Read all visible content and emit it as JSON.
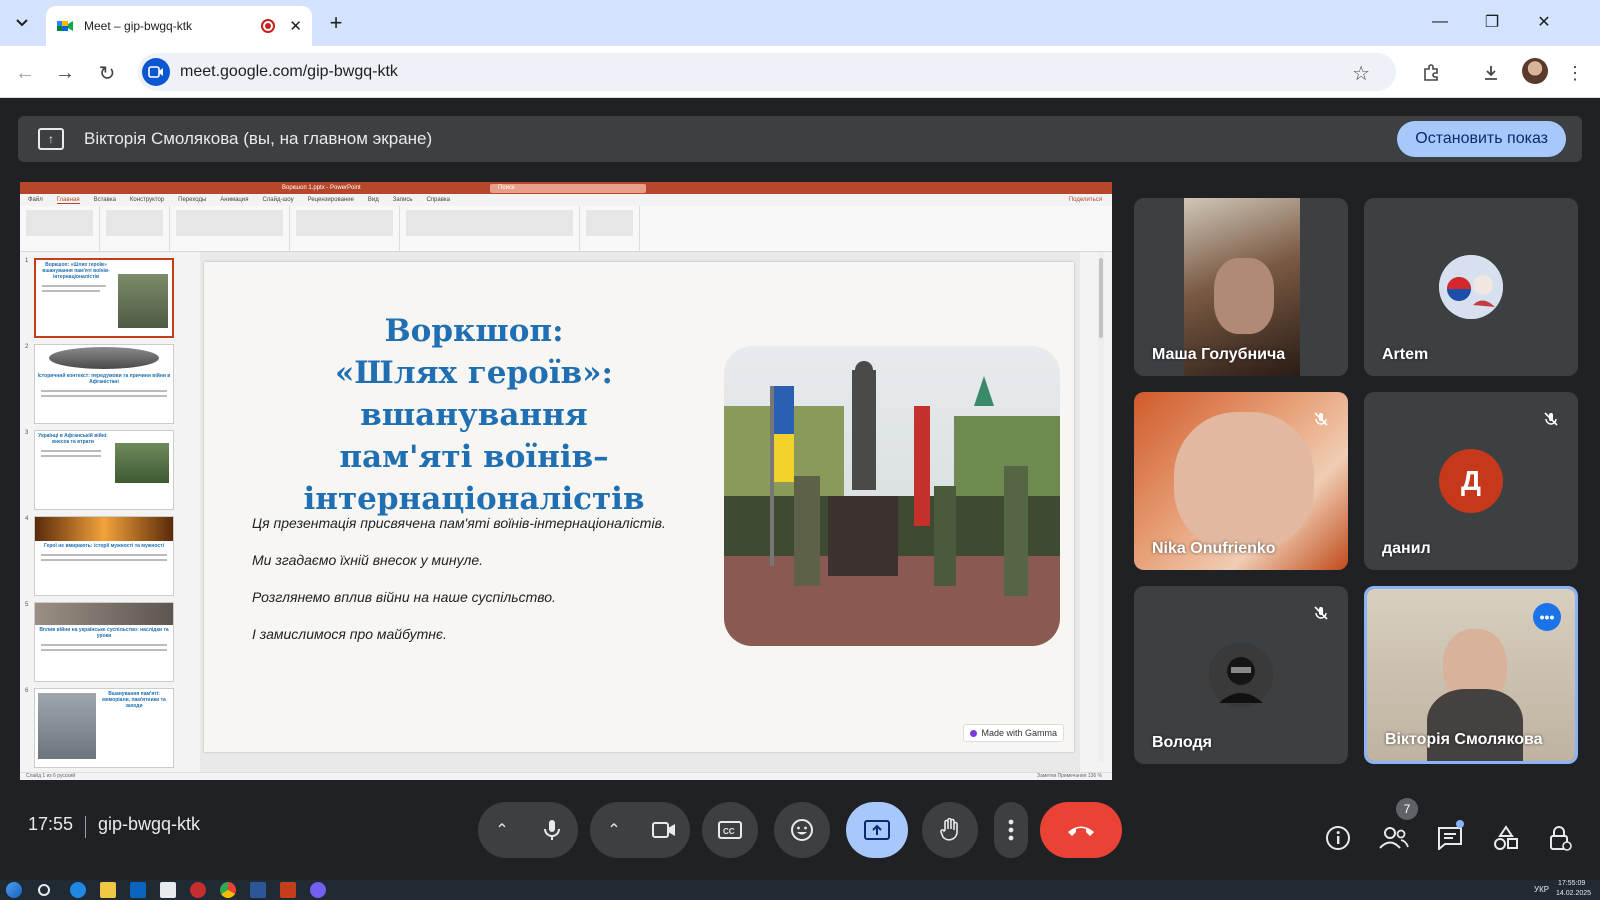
{
  "browser": {
    "tab_title": "Meet – gip-bwgq-ktk",
    "url": "meet.google.com/gip-bwgq-ktk"
  },
  "banner": {
    "text": "Вікторія Смолякова (вы, на главном экране)",
    "stop_button": "Остановить показ"
  },
  "ppt": {
    "window_title": "Воркшоп 1.pptx - PowerPoint",
    "search_placeholder": "Поиск",
    "menu": [
      "Файл",
      "Главная",
      "Вставка",
      "Конструктор",
      "Переходы",
      "Анимация",
      "Слайд-шоу",
      "Рецензирование",
      "Вид",
      "Запись",
      "Справка"
    ],
    "share_label": "Поделиться",
    "status_left": "Слайд 1 из 6   русский",
    "status_right": "Заметки   Примечания   136 %",
    "thumbnails": [
      {
        "num": "1",
        "title": "Воркшоп: «Шлях героїв» вшанування пам'яті воїнів-інтернаціоналістів"
      },
      {
        "num": "2",
        "title": "Історичний контекст: передумови та причини війни в Афганістані"
      },
      {
        "num": "3",
        "title": "Українці в Афганській війні: внесок та втрати"
      },
      {
        "num": "4",
        "title": "Герої не вмирають: історії мужності та мужності"
      },
      {
        "num": "5",
        "title": "Вплив війни на українське суспільство: наслідки та уроки"
      },
      {
        "num": "6",
        "title": "Вшанування пам'яті: меморіали, пам'ятники та заходи"
      }
    ],
    "slide": {
      "title_lines": [
        "Воркшоп:",
        "«Шлях героїв»: вшанування",
        "пам'яті воїнів–",
        "інтернаціоналістів"
      ],
      "body_lines": [
        "Ця презентація присвячена пам'яті воїнів-інтернаціоналістів.",
        "Ми згадаємо їхній внесок у минуле.",
        "Розглянемо вплив війни на наше суспільство.",
        "І замислимося про майбутнє."
      ],
      "badge": "Made with Gamma"
    }
  },
  "participants": [
    {
      "name": "Маша Голубнича",
      "muted": false
    },
    {
      "name": "Artem",
      "muted": false
    },
    {
      "name": "Nika Onufrienko",
      "muted": true
    },
    {
      "name": "данил",
      "muted": true,
      "initial": "Д"
    },
    {
      "name": "Володя",
      "muted": true
    },
    {
      "name": "Вікторія Смолякова",
      "muted": false
    }
  ],
  "controls": {
    "time": "17:55",
    "meeting_code": "gip-bwgq-ktk",
    "people_count": "7"
  },
  "taskbar": {
    "lang": "УКР",
    "time": "17:55:09",
    "date": "14.02.2025"
  },
  "colors": {
    "accent": "#a8c7fa",
    "end_call": "#ea4335",
    "slide_title": "#1f6fb2",
    "ppt_brand": "#b7472a"
  }
}
